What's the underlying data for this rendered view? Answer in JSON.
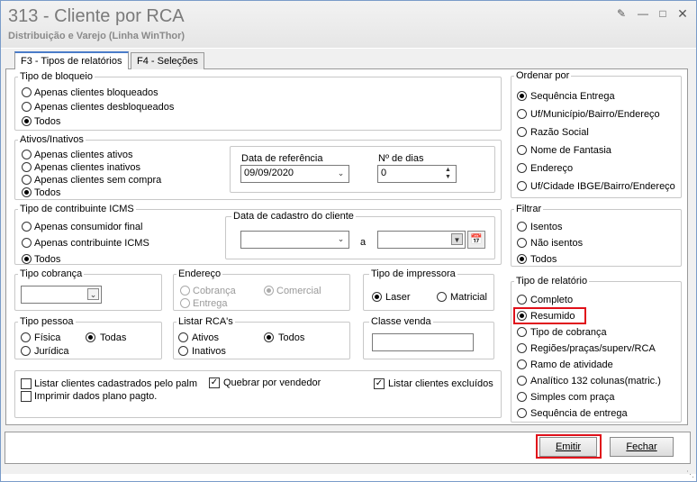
{
  "window": {
    "title": "313 - Cliente por RCA",
    "subtitle": "Distribuição e Varejo (Linha WinThor)"
  },
  "tabs": [
    "F3 - Tipos de relatórios",
    "F4 - Seleções"
  ],
  "tipo_bloqueio": {
    "title": "Tipo de bloqueio",
    "options": [
      "Apenas clientes bloqueados",
      "Apenas clientes desbloqueados",
      "Todos"
    ],
    "selected": 2
  },
  "ativos": {
    "title": "Ativos/Inativos",
    "options": [
      "Apenas clientes ativos",
      "Apenas clientes inativos",
      "Apenas clientes sem compra",
      "Todos"
    ],
    "selected": 3
  },
  "data_ref": {
    "label": "Data de referência",
    "value": "09/09/2020"
  },
  "num_dias": {
    "label": "Nº de dias",
    "value": "0"
  },
  "contribuinte": {
    "title": "Tipo de contribuinte ICMS",
    "options": [
      "Apenas consumidor final",
      "Apenas contribuinte ICMS",
      "Todos"
    ],
    "selected": 2
  },
  "data_cadastro": {
    "title": "Data de cadastro do cliente",
    "sep": "a"
  },
  "tipo_cobranca": {
    "title": "Tipo cobrança"
  },
  "endereco": {
    "title": "Endereço",
    "options": [
      "Cobrança",
      "Comercial",
      "Entrega"
    ]
  },
  "impressora": {
    "title": "Tipo de impressora",
    "options": [
      "Laser",
      "Matricial"
    ]
  },
  "tipo_pessoa": {
    "title": "Tipo pessoa",
    "options": [
      "Física",
      "Todas",
      "Jurídica"
    ]
  },
  "listar_rca": {
    "title": "Listar RCA's",
    "options": [
      "Ativos",
      "Todos",
      "Inativos"
    ]
  },
  "classe_venda": {
    "title": "Classe venda"
  },
  "checks": {
    "palm": "Listar clientes cadastrados pelo palm",
    "quebrar": "Quebrar por vendedor",
    "excluidos": "Listar clientes excluídos",
    "plano": "Imprimir dados plano pagto."
  },
  "ordenar": {
    "title": "Ordenar por",
    "options": [
      "Sequência Entrega",
      "Uf/Município/Bairro/Endereço",
      "Razão Social",
      "Nome de Fantasia",
      "Endereço",
      "Uf/Cidade IBGE/Bairro/Endereço"
    ],
    "selected": 0
  },
  "filtrar": {
    "title": "Filtrar",
    "options": [
      "Isentos",
      "Não isentos",
      "Todos"
    ],
    "selected": 2
  },
  "tipo_relatorio": {
    "title": "Tipo de relatório",
    "options": [
      "Completo",
      "Resumido",
      "Tipo de cobrança",
      "Regiões/praças/superv/RCA",
      "Ramo de atividade",
      "Analítico 132 colunas(matric.)",
      "Simples com praça",
      "Sequência de entrega"
    ],
    "selected": 1
  },
  "buttons": {
    "emitir": "Emitir",
    "fechar": "Fechar"
  },
  "colors": {
    "highlight": "#e0101a",
    "tab_accent": "#4a7cc9"
  }
}
